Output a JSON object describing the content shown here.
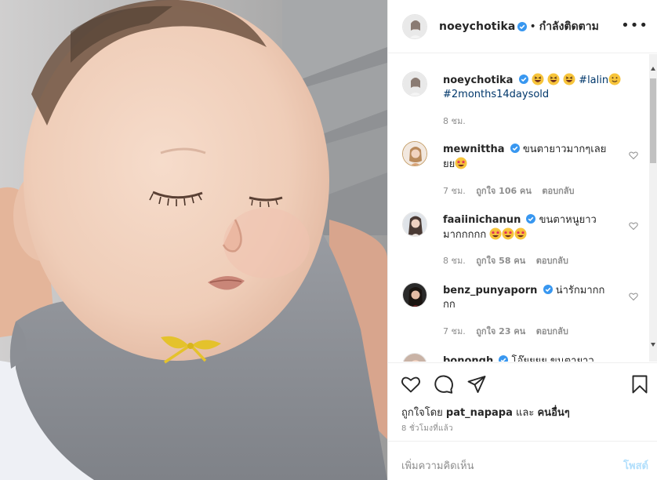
{
  "colors": {
    "verified": "#3897f0",
    "hashtag": "#00376b",
    "muted": "#8e8e8e",
    "post_disabled": "#b2dffc",
    "border": "#efefef"
  },
  "header": {
    "username": "noeychotika",
    "separator": "•",
    "follow_status": "กำลังติดตาม",
    "more": "•••"
  },
  "caption": {
    "username": "noeychotika",
    "hashtag1": "#lalin",
    "hashtag2": "#2months14daysold",
    "time": "8 ชม.",
    "emojis": [
      "grinning-squinting-face",
      "grinning-squinting-face",
      "grinning-squinting-face",
      "slightly-smiling-face"
    ]
  },
  "comments": [
    {
      "username": "mewnittha",
      "text": "ขนตายาวมากๆเลยยย",
      "emoji": "star-struck",
      "time": "7 ชม.",
      "likes": "ถูกใจ 106 คน",
      "reply": "ตอบกลับ"
    },
    {
      "username": "faaiinichanun",
      "text": "ขนตาหนูยาวมากกกกก",
      "emoji": "star-struck-x3",
      "time": "8 ชม.",
      "likes": "ถูกใจ 58 คน",
      "reply": "ตอบกลับ"
    },
    {
      "username": "benz_punyaporn",
      "text": "น่ารักมากกกก",
      "emoji": "",
      "time": "7 ชม.",
      "likes": "ถูกใจ 23 คน",
      "reply": "ตอบกลับ"
    },
    {
      "username": "bonongh",
      "text": "โอ๊ยยยย ขนตายาวววว",
      "emoji": "",
      "time": "",
      "likes": "",
      "reply": ""
    }
  ],
  "actions": {
    "icons": [
      "heart-icon",
      "comment-icon",
      "share-icon",
      "bookmark-icon"
    ],
    "liked_by_prefix": "ถูกใจโดย",
    "liked_by_user": "pat_napapa",
    "liked_by_and": "และ",
    "liked_by_others": "คนอื่นๆ",
    "time": "8 ชั่วโมงที่แล้ว"
  },
  "add_comment": {
    "placeholder": "เพิ่มความคิดเห็น",
    "post_label": "โพสต์"
  }
}
